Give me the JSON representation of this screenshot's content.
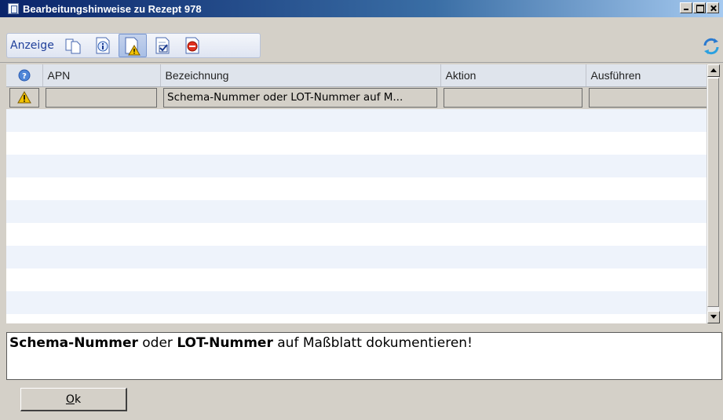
{
  "window": {
    "title": "Bearbeitungshinweise zu Rezept 978"
  },
  "toolbar": {
    "label": "Anzeige",
    "tools": [
      {
        "icon": "copy-pages-icon"
      },
      {
        "icon": "info-icon"
      },
      {
        "icon": "warning-document-icon",
        "active": true
      },
      {
        "icon": "checked-document-icon"
      },
      {
        "icon": "stop-icon"
      }
    ],
    "refresh_icon": "refresh-icon"
  },
  "grid": {
    "columns": [
      "",
      "APN",
      "Bezeichnung",
      "Aktion",
      "Ausführen"
    ],
    "header_icon": "help-icon",
    "rows": [
      {
        "status_icon": "warning-icon",
        "apn": "",
        "bezeichnung": "Schema-Nummer oder LOT-Nummer auf M...",
        "aktion": "",
        "ausfuehren": ""
      }
    ]
  },
  "detail": {
    "part1": "Schema-Nummer",
    "part2": " oder ",
    "part3": "LOT-Nummer",
    "part4": " auf Maßblatt dokumentieren!"
  },
  "buttons": {
    "ok_first": "O",
    "ok_rest": "k"
  },
  "colors": {
    "title_gradient_start": "#0a246a",
    "row_stripe": "#eef3fb",
    "warning": "#f2c200"
  }
}
